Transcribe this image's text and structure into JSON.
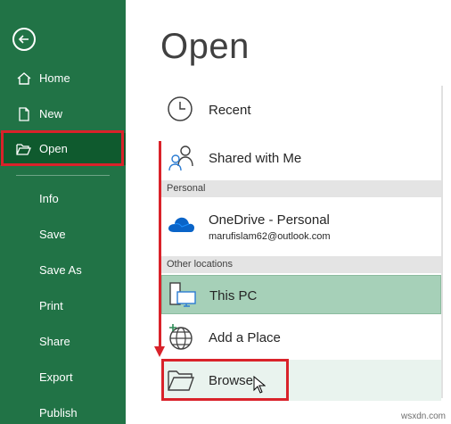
{
  "sidebar": {
    "back_label": "",
    "items": [
      {
        "label": "Home",
        "icon": "home-icon"
      },
      {
        "label": "New",
        "icon": "new-document-icon"
      },
      {
        "label": "Open",
        "icon": "folder-open-icon"
      },
      {
        "label": "Info"
      },
      {
        "label": "Save"
      },
      {
        "label": "Save As"
      },
      {
        "label": "Print"
      },
      {
        "label": "Share"
      },
      {
        "label": "Export"
      },
      {
        "label": "Publish"
      }
    ]
  },
  "main": {
    "title": "Open",
    "recent": {
      "label": "Recent",
      "icon": "clock-icon"
    },
    "shared": {
      "label": "Shared with Me",
      "icon": "people-icon"
    },
    "section_personal": "Personal",
    "onedrive": {
      "label": "OneDrive - Personal",
      "email": "marufislam62@outlook.com",
      "icon": "cloud-icon"
    },
    "section_other": "Other locations",
    "this_pc": {
      "label": "This PC",
      "icon": "computer-icon"
    },
    "add_place": {
      "label": "Add a Place",
      "icon": "globe-icon"
    },
    "browse": {
      "label": "Browse",
      "icon": "folder-icon"
    }
  },
  "watermark": "wsxdn.com",
  "colors": {
    "sidebar_bg": "#217346",
    "sidebar_active": "#0f5a2e",
    "highlight_red": "#d9222a",
    "selected_row": "#a6d0b8",
    "onedrive_blue": "#0a64c8"
  }
}
